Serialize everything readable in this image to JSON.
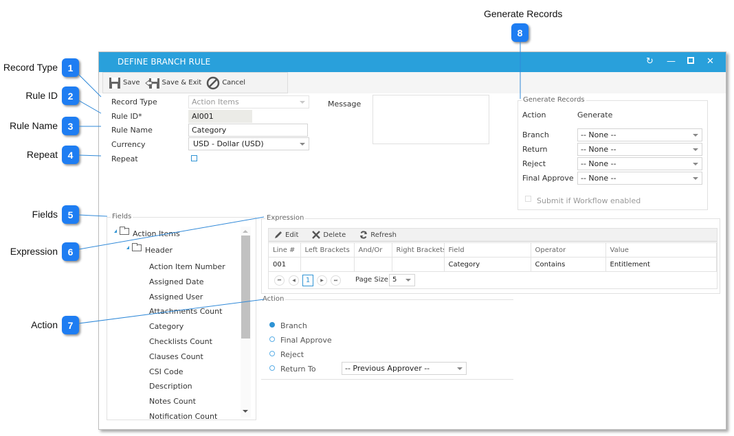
{
  "callouts": [
    {
      "number": "1",
      "label": "Record Type"
    },
    {
      "number": "2",
      "label": "Rule ID"
    },
    {
      "number": "3",
      "label": "Rule Name"
    },
    {
      "number": "4",
      "label": "Repeat"
    },
    {
      "number": "5",
      "label": "Fields"
    },
    {
      "number": "6",
      "label": "Expression"
    },
    {
      "number": "7",
      "label": "Action"
    },
    {
      "number": "8",
      "label": "Generate Records"
    }
  ],
  "window": {
    "title": "DEFINE BRANCH RULE",
    "controls": {
      "refresh": "refresh-icon",
      "minimize": "minimize-icon",
      "maximize": "maximize-icon",
      "close": "close-icon"
    }
  },
  "toolbar": {
    "save_label": "Save",
    "save_exit_label": "Save & Exit",
    "cancel_label": "Cancel"
  },
  "form": {
    "record_type": {
      "label": "Record Type",
      "value": "Action Items"
    },
    "rule_id": {
      "label": "Rule ID*",
      "value": "AI001"
    },
    "rule_name": {
      "label": "Rule Name",
      "value": "Category"
    },
    "currency": {
      "label": "Currency",
      "value": "USD - Dollar (USD)"
    },
    "repeat": {
      "label": "Repeat",
      "checked": false
    },
    "message": {
      "label": "Message",
      "value": ""
    }
  },
  "generate_records": {
    "legend": "Generate Records",
    "header_action": "Action",
    "header_generate": "Generate",
    "rows": [
      {
        "label": "Branch",
        "value": "-- None --"
      },
      {
        "label": "Return",
        "value": "-- None --"
      },
      {
        "label": "Reject",
        "value": "-- None --"
      },
      {
        "label": "Final Approve",
        "value": "-- None --"
      }
    ],
    "submit_label": "Submit if Workflow enabled",
    "submit_checked": false
  },
  "fields": {
    "legend": "Fields",
    "root": "Action Items",
    "group": "Header",
    "items": [
      "Action Item Number",
      "Assigned Date",
      "Assigned User",
      "Attachments Count",
      "Category",
      "Checklists Count",
      "Clauses Count",
      "CSI Code",
      "Description",
      "Notes Count",
      "Notification Count"
    ]
  },
  "expression": {
    "legend": "Expression",
    "tools": {
      "edit": "Edit",
      "delete": "Delete",
      "refresh": "Refresh"
    },
    "columns": [
      "Line #",
      "Left Brackets",
      "And/Or",
      "Right Brackets",
      "Field",
      "Operator",
      "Value"
    ],
    "rows": [
      [
        "001",
        "",
        "",
        "",
        "Category",
        "Contains",
        "Entitlement"
      ]
    ],
    "pager": {
      "current_page": "1",
      "page_size_label": "Page Size",
      "page_size": "5"
    }
  },
  "action": {
    "legend": "Action",
    "options": [
      "Branch",
      "Final Approve",
      "Reject",
      "Return To"
    ],
    "selected": "Branch",
    "return_to_value": "-- Previous Approver --"
  },
  "colors": {
    "titlebar": "#29a0db",
    "badge": "#1e7df2",
    "accent": "#2e93d4"
  }
}
